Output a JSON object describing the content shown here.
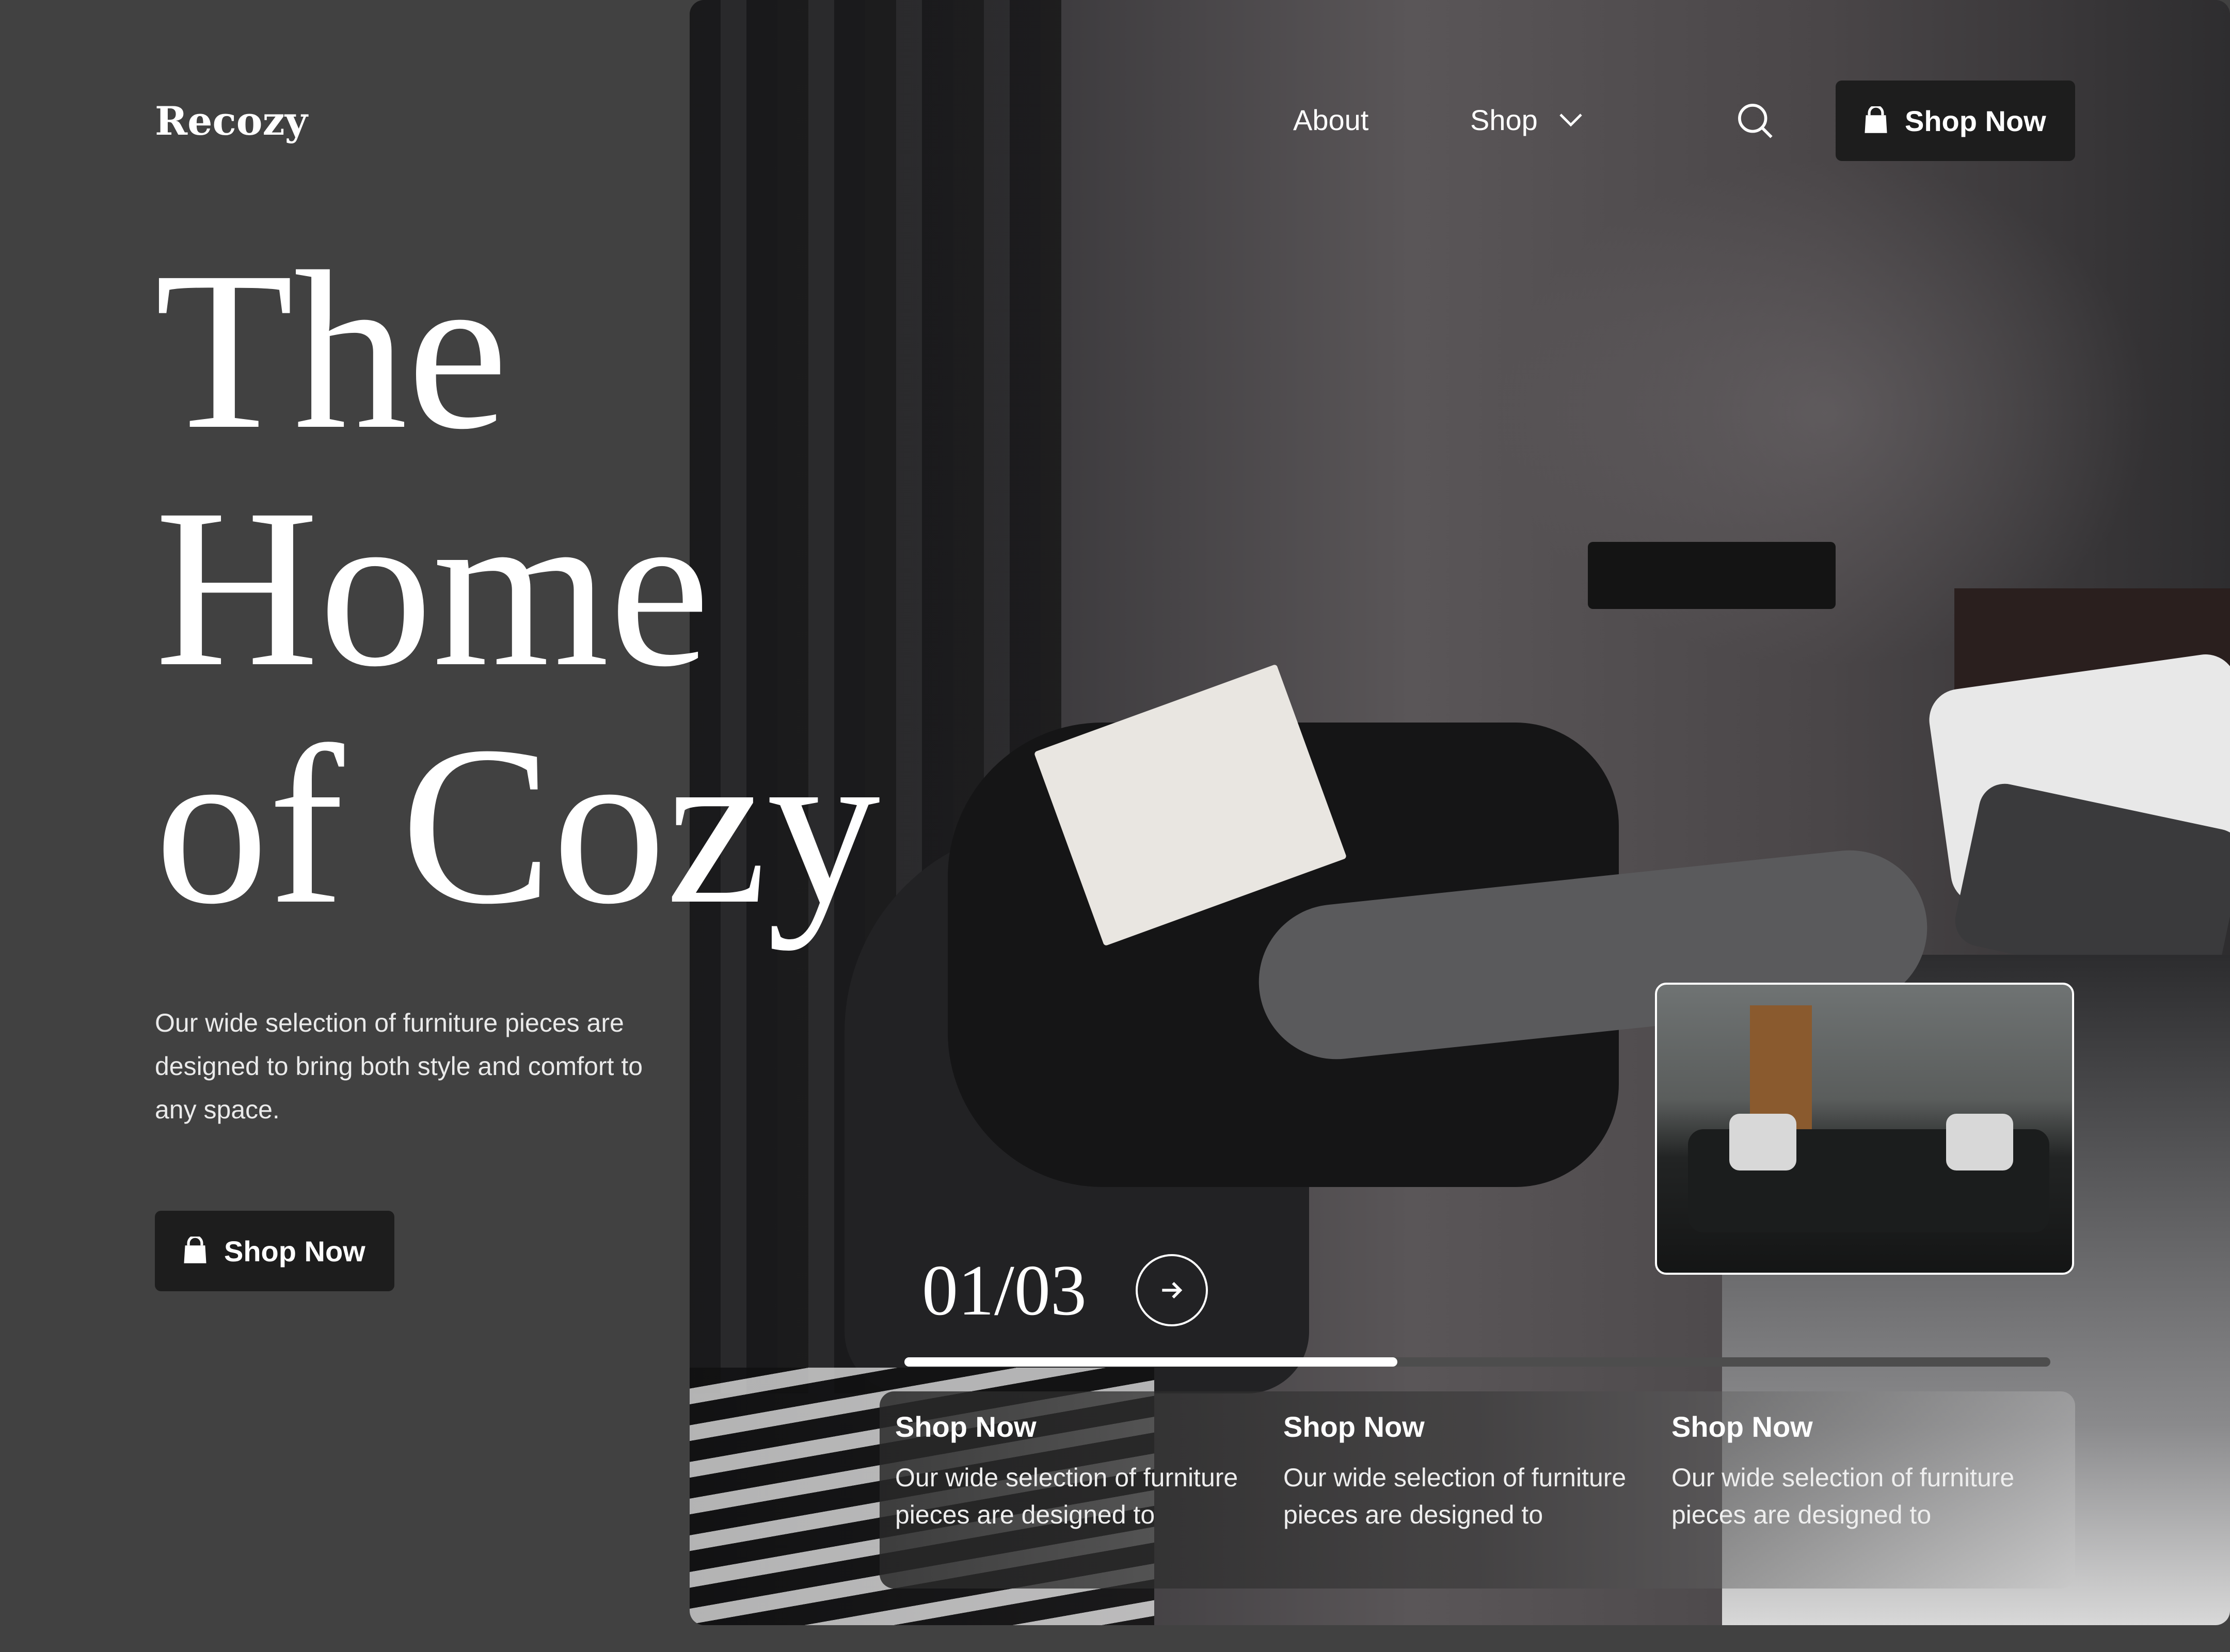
{
  "brand": {
    "logo": "Recozy"
  },
  "nav": {
    "about": "About",
    "shop": "Shop",
    "cta": "Shop Now"
  },
  "hero": {
    "headline_line1": "The",
    "headline_line2": "Home",
    "headline_line3": "of Cozy",
    "intro": "Our wide selection of furniture pieces are designed to bring both style and comfort to any space.",
    "cta": "Shop Now"
  },
  "slider": {
    "counter": "01/03",
    "current": 1,
    "total": 3,
    "progress": 0.43
  },
  "cards": [
    {
      "title": "Shop Now",
      "text": "Our wide selection of furniture pieces are designed to"
    },
    {
      "title": "Shop Now",
      "text": "Our wide selection of furniture pieces are designed to"
    },
    {
      "title": "Shop Now",
      "text": "Our wide selection of furniture pieces are designed to"
    }
  ],
  "colors": {
    "background": "#414141",
    "button": "#1d1d1d",
    "text": "#ffffff"
  },
  "icons": [
    "shopping-bag-icon",
    "search-icon",
    "chevron-down-icon",
    "arrow-right-icon"
  ]
}
